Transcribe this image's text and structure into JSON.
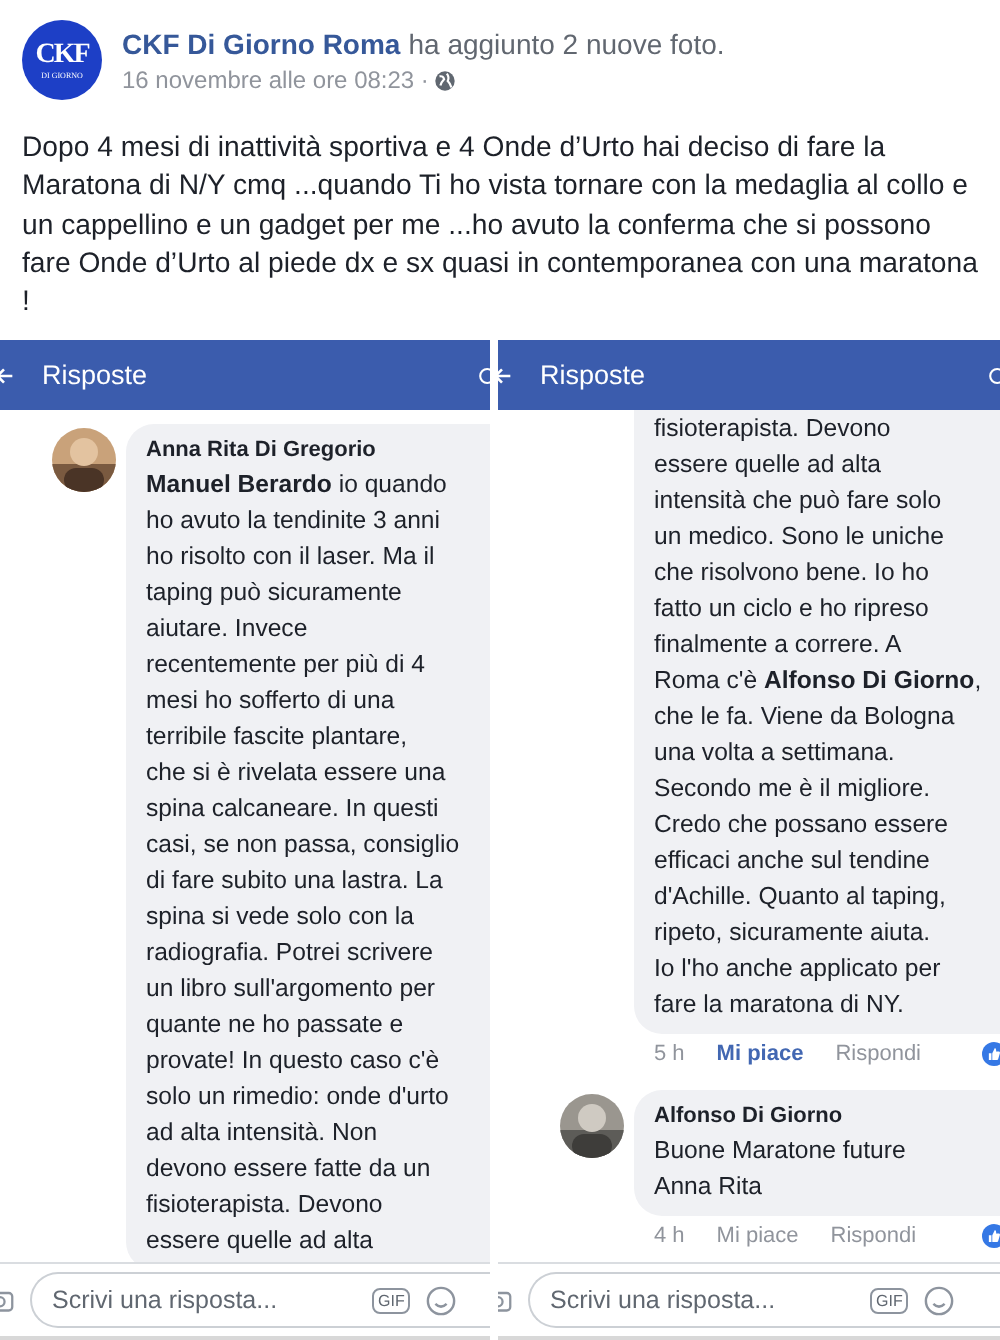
{
  "post": {
    "logo": {
      "title": "CKF",
      "subtitle": "DI GIORNO"
    },
    "author": "CKF Di Giorno Roma",
    "action": "ha aggiunto 2 nuove foto.",
    "time": "16 novembre alle ore 08:23 ·",
    "text": "Dopo 4 mesi di inattività sportiva e 4 Onde d’Urto hai deciso di fare la Maratona di N/Y cmq ...quando Ti ho vista tornare con la medaglia al collo e un cappellino e un gadget per me ...ho avuto la conferma che si possono fare Onde d’Urto al piede dx e sx quasi in contemporanea con una maratona !"
  },
  "photos": [
    {
      "header": "Risposte",
      "comments": [
        {
          "avatar": true,
          "name": "Anna Rita Di Gregorio",
          "lines": [
            "**Manuel Berardo** io quando",
            "ho avuto la tendinite 3 anni",
            "ho risolto con il laser. Ma il",
            "taping può sicuramente",
            "aiutare. Invece",
            "recentemente per più di 4",
            "mesi ho sofferto di una",
            "terribile fascite plantare,",
            "che si è rivelata essere una",
            "spina calcaneare. In questi",
            "casi, se non passa, consiglio",
            "di fare subito una lastra. La",
            "spina si vede solo con la",
            "radiografia. Potrei scrivere",
            "un libro sull'argomento per",
            "quante ne ho passate e",
            "provate! In questo caso c'è",
            "solo un rimedio: onde d'urto",
            "ad alta intensità. Non",
            "devono essere fatte da un",
            "fisioterapista. Devono",
            "essere quelle ad alta"
          ]
        }
      ],
      "reply_placeholder": "Scrivi una risposta...",
      "gif": "GIF"
    },
    {
      "header": "Risposte",
      "comments": [
        {
          "lines": [
            "fisioterapista. Devono",
            "essere quelle ad alta",
            "intensità che può fare solo",
            "un medico. Sono le uniche",
            "che risolvono bene. Io ho",
            "fatto un ciclo e ho ripreso",
            "finalmente a correre. A",
            "Roma c'è **Alfonso Di Giorno**,",
            "che le fa. Viene da Bologna",
            "una volta a settimana.",
            "Secondo me è il migliore.",
            "Credo che possano essere",
            "efficaci anche sul tendine",
            "d'Achille. Quanto al taping,",
            "ripeto, sicuramente aiuta.",
            "Io l'ho anche applicato per",
            "fare la maratona di NY."
          ],
          "meta": {
            "time": "5 h",
            "like": "Mi piace",
            "liked": true,
            "reply": "Rispondi"
          }
        },
        {
          "avatar": true,
          "name": "Alfonso Di Giorno",
          "lines": [
            "Buone Maratone future",
            "Anna Rita"
          ],
          "meta": {
            "time": "4 h",
            "like": "Mi piace",
            "liked": false,
            "reply": "Rispondi"
          }
        }
      ],
      "reply_placeholder": "Scrivi una risposta...",
      "gif": "GIF"
    }
  ]
}
